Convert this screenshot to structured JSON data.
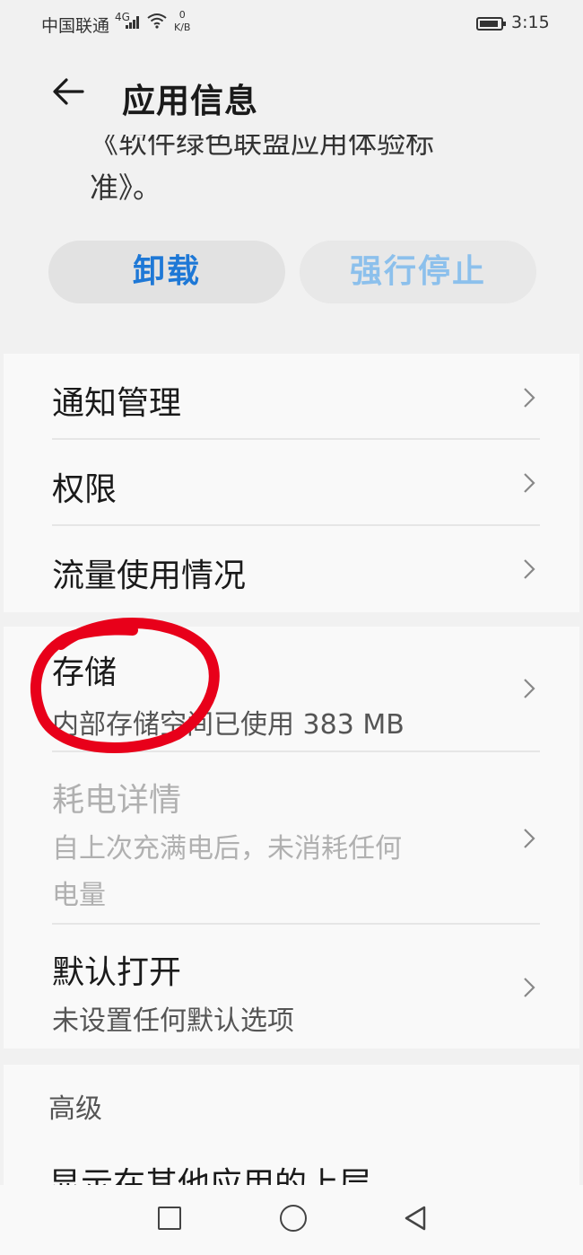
{
  "status_bar": {
    "carrier": "中国联通",
    "signal_type": "4G",
    "speed_value": "0",
    "speed_unit": "K/B",
    "time": "3:15",
    "icons": [
      "signal-icon",
      "wifi-icon",
      "battery-icon"
    ]
  },
  "header": {
    "title": "应用信息",
    "back_icon": "back-arrow-icon"
  },
  "description": {
    "partial_line": "《软件绿色联盟应用体验标",
    "last_line": "准》。"
  },
  "actions": {
    "uninstall_label": "卸载",
    "force_stop_label": "强行停止"
  },
  "settings_group1": {
    "items": [
      {
        "title": "通知管理"
      },
      {
        "title": "权限"
      },
      {
        "title": "流量使用情况"
      }
    ]
  },
  "settings_group2": {
    "items": [
      {
        "title": "存储",
        "subtitle": "内部存储空间已使用 383 MB"
      },
      {
        "title": "耗电详情",
        "subtitle_line1": "自上次充满电后，未消耗任何",
        "subtitle_line2": "电量"
      },
      {
        "title": "默认打开",
        "subtitle": "未设置任何默认选项"
      }
    ]
  },
  "advanced": {
    "label": "高级",
    "first_item": "显示在其他应用的上层"
  },
  "nav_bar": {
    "icons": [
      "recent-apps-icon",
      "home-icon",
      "back-icon"
    ]
  },
  "colors": {
    "accent": "#1e78d6",
    "accent_disabled": "#8cc0ec",
    "annotation": "#e8001a"
  }
}
